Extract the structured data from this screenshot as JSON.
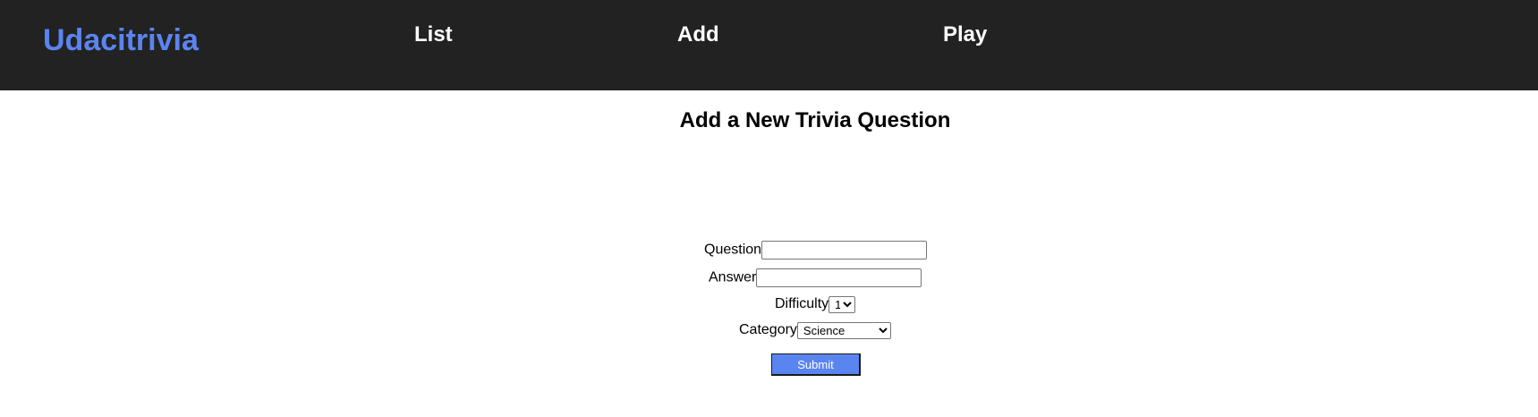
{
  "navbar": {
    "brand": "Udacitrivia",
    "links": [
      "List",
      "Add",
      "Play"
    ],
    "background_color": "#222222",
    "brand_color": "#5a84f0"
  },
  "form": {
    "title": "Add a New Trivia Question",
    "question": {
      "label": "Question",
      "value": ""
    },
    "answer": {
      "label": "Answer",
      "value": ""
    },
    "difficulty": {
      "label": "Difficulty",
      "selected": "1"
    },
    "category": {
      "label": "Category",
      "selected": "Science"
    },
    "submit_label": "Submit",
    "submit_color": "#5a84f0"
  }
}
